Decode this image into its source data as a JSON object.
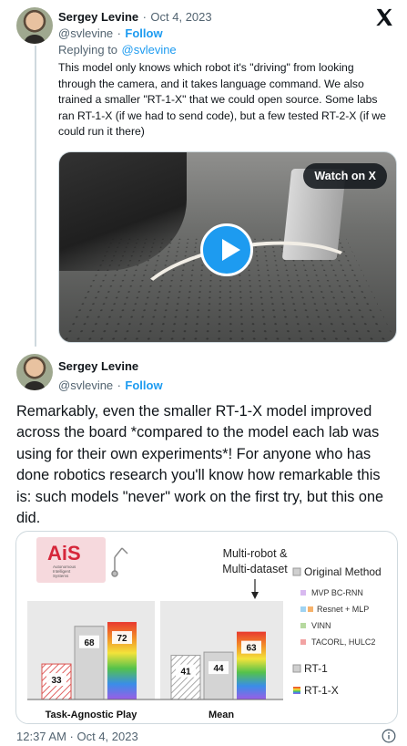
{
  "tweet1": {
    "author_name": "Sergey Levine",
    "separator": "·",
    "date": "Oct 4, 2023",
    "handle": "@svlevine",
    "follow_label": "Follow",
    "replying_prefix": "Replying to",
    "replying_handle": "@svlevine",
    "text": "This model only knows which robot it's \"driving\" from looking through the camera, and it takes language command. We also trained a smaller \"RT-1-X\" that we could open source. Some labs ran RT-1-X (if we had to send code), but a few tested RT-2-X (if we could run it there)",
    "video": {
      "watch_label": "Watch on X"
    }
  },
  "tweet2": {
    "author_name": "Sergey Levine",
    "handle": "@svlevine",
    "follow_label": "Follow",
    "text": "Remarkably, even the smaller RT-1-X model improved across the board *compared to the model each lab was using for their own experiments*! For anyone who has done robotics research you'll know how remarkable this is: such models \"never\" work on the first try, but this one did.",
    "timestamp": "12:37 AM · Oct 4, 2023"
  },
  "icons": {
    "logo": "x-logo-icon",
    "play": "play-icon",
    "info": "info-icon"
  },
  "colors": {
    "accent": "#1d9bf0",
    "text": "#0f1419",
    "muted": "#536471"
  },
  "chart_data": {
    "type": "bar",
    "logo_text": "AiS",
    "logo_subtext": [
      "Autonomous",
      "Intelligent",
      "Systems"
    ],
    "annotation": [
      "Multi-robot &",
      "Multi-dataset"
    ],
    "groups": [
      {
        "label": "Task-Agnostic Play",
        "bars": [
          {
            "series": "Original Method",
            "value": 33
          },
          {
            "series": "RT-1",
            "value": 68
          },
          {
            "series": "RT-1-X",
            "value": 72
          }
        ]
      },
      {
        "label": "Mean",
        "bars": [
          {
            "series": "Original Method",
            "value": 41
          },
          {
            "series": "RT-1",
            "value": 44
          },
          {
            "series": "RT-1-X",
            "value": 63
          }
        ]
      }
    ],
    "legend": {
      "header": "Original Method",
      "sub_items": [
        "MVP BC-RNN",
        "Resnet + MLP",
        "VINN",
        "TACORL, HULC2"
      ],
      "items": [
        "RT-1",
        "RT-1-X"
      ]
    },
    "ylim": [
      0,
      100
    ]
  }
}
